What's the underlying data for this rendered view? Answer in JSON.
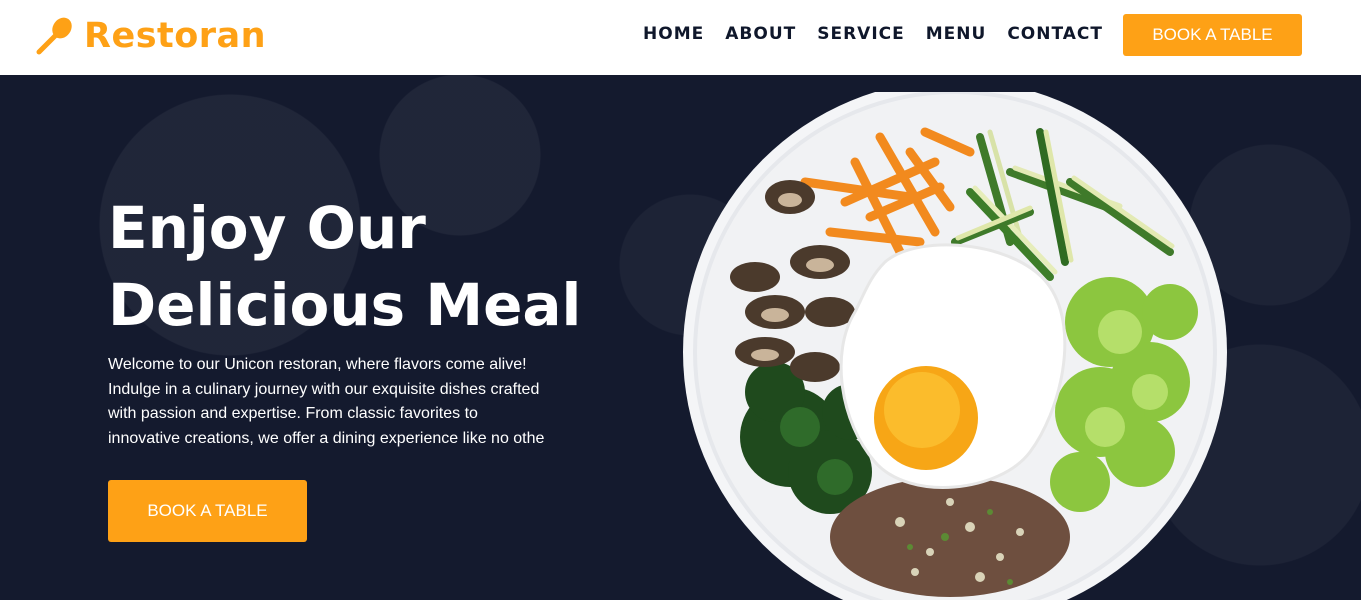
{
  "brand": {
    "name": "Restoran",
    "accent": "#fea116",
    "icon": "spoon-icon"
  },
  "nav": {
    "items": [
      {
        "label": "HOME"
      },
      {
        "label": "ABOUT"
      },
      {
        "label": "SERVICE"
      },
      {
        "label": "MENU"
      },
      {
        "label": "CONTACT"
      }
    ],
    "cta_label": "BOOK A TABLE"
  },
  "hero": {
    "title_lines": [
      "Enjoy Our",
      "Delicious Meal"
    ],
    "text_lines": [
      "Welcome to our Unicon restoran, where flavors come alive!",
      "Indulge in a culinary journey with our exquisite dishes crafted",
      "with passion and expertise. From classic favorites to",
      "innovative creations, we offer a dining experience like no othe"
    ],
    "cta_label": "BOOK A TABLE",
    "background": "#0f172b"
  }
}
